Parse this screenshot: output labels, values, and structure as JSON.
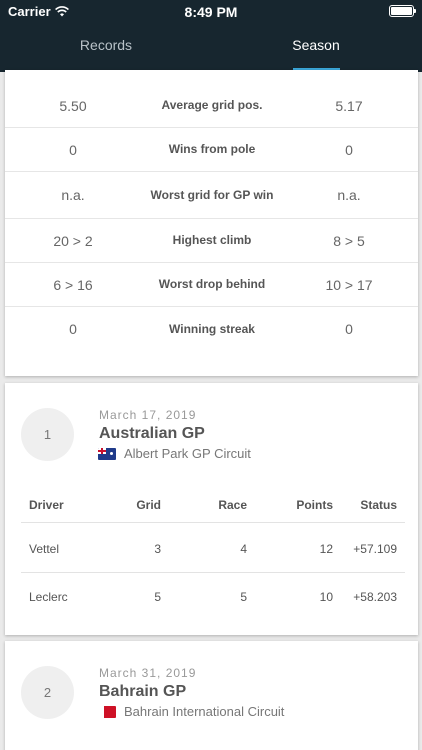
{
  "status_bar": {
    "carrier": "Carrier",
    "time": "8:49 PM"
  },
  "tabs": [
    {
      "label": "Records"
    },
    {
      "label": "Season"
    }
  ],
  "stats": [
    {
      "label": "Average grid pos.",
      "left": "5.50",
      "right": "5.17"
    },
    {
      "label": "Wins from pole",
      "left": "0",
      "right": "0"
    },
    {
      "label": "Worst grid for GP win",
      "left": "n.a.",
      "right": "n.a."
    },
    {
      "label": "Highest climb",
      "left": "20 > 2",
      "right": "8 > 5"
    },
    {
      "label": "Worst drop behind",
      "left": "6 > 16",
      "right": "10 > 17"
    },
    {
      "label": "Winning streak",
      "left": "0",
      "right": "0"
    }
  ],
  "races": [
    {
      "round": "1",
      "date": "March 17, 2019",
      "name": "Australian GP",
      "circuit": "Albert Park GP Circuit",
      "flag_icon": "australia-flag-icon",
      "columns": {
        "driver": "Driver",
        "grid": "Grid",
        "race": "Race",
        "points": "Points",
        "status": "Status"
      },
      "results": [
        {
          "driver": "Vettel",
          "grid": "3",
          "race": "4",
          "points": "12",
          "status": "+57.109"
        },
        {
          "driver": "Leclerc",
          "grid": "5",
          "race": "5",
          "points": "10",
          "status": "+58.203"
        }
      ]
    },
    {
      "round": "2",
      "date": "March 31, 2019",
      "name": "Bahrain GP",
      "circuit": "Bahrain International Circuit",
      "flag_icon": "bahrain-flag-icon"
    }
  ],
  "colors": {
    "header_bg": "#17262f",
    "tab_indicator": "#3aa6d8",
    "page_bg": "#eaeaea"
  }
}
